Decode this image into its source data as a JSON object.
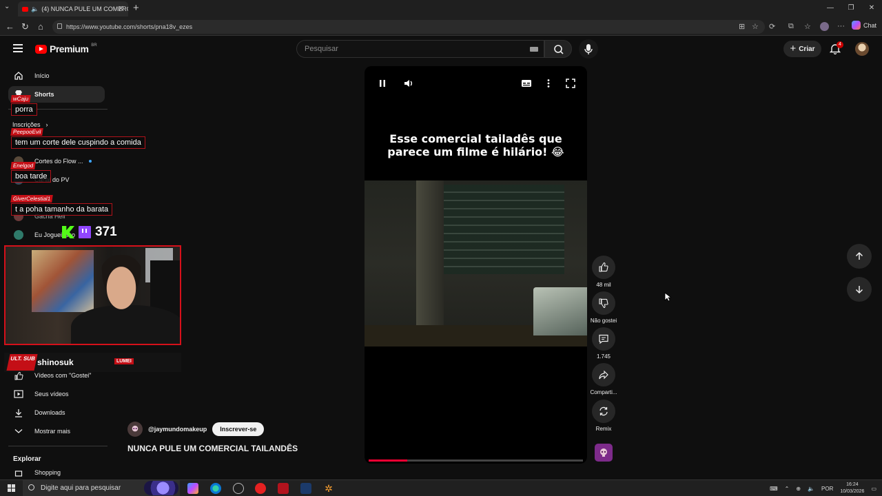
{
  "browser": {
    "tab_title": "(4) NUNCA PULE UM COMERCI",
    "url": "https://www.youtube.com/shorts/pna18v_ezes",
    "chat_label": "Chat"
  },
  "yt": {
    "logo_text": "Premium",
    "logo_region": "BR",
    "search_placeholder": "Pesquisar",
    "create_label": "Criar",
    "notif_count": "4"
  },
  "sidebar": {
    "items": [
      {
        "label": "Início",
        "icon": "home-icon"
      },
      {
        "label": "Shorts",
        "icon": "shorts-icon"
      },
      {
        "label": "Inscrições",
        "icon": "subscriptions-icon"
      }
    ],
    "subs": [
      {
        "label": "Cortes do Flow ..."
      },
      {
        "label": "Canal do PV"
      },
      {
        "label": "Gacha Hell"
      },
      {
        "label": "Eu Joguei Isso"
      }
    ],
    "you": [
      {
        "label": "Vídeos com \"Gostei\"",
        "icon": "like-icon"
      },
      {
        "label": "Seus vídeos",
        "icon": "your-videos-icon"
      },
      {
        "label": "Downloads",
        "icon": "download-icon"
      },
      {
        "label": "Mostrar mais",
        "icon": "chevron-down-icon"
      }
    ],
    "explore_heading": "Explorar",
    "explore_first": "Shopping"
  },
  "chat": [
    {
      "user": "wCaju",
      "text": "porra"
    },
    {
      "user": "PeepooEvil",
      "text": "tem um corte dele cuspindo a comida"
    },
    {
      "user": "Enelgod",
      "text": "boa tarde"
    },
    {
      "user": "GiverCelestial1",
      "text": "t a poha tamanho da barata"
    }
  ],
  "stream": {
    "viewers": "371",
    "streamer": "shinosuk",
    "badge": "ULT. SUB",
    "sponsor": "LUMEI"
  },
  "short": {
    "caption_line1": "Esse comercial tailadês que",
    "caption_line2": "parece um filme é hilário! 😂",
    "channel": "@jaymundomakeup",
    "subscribe": "Inscrever-se",
    "title": "NUNCA PULE UM COMERCIAL TAILANDÊS",
    "progress": 0.18
  },
  "actions": {
    "likes": "48 mil",
    "dislike": "Não gostei",
    "comments": "1.745",
    "share": "Comparti...",
    "remix": "Remix"
  },
  "taskbar": {
    "search_placeholder": "Digite aqui para pesquisar",
    "lang": "POR",
    "time": "16:24",
    "date": "10/03/2026"
  },
  "colors": {
    "yt_red": "#ff0000",
    "chat_red": "#c40f16",
    "progress": "#ff0033",
    "bg": "#0f0f0f"
  }
}
